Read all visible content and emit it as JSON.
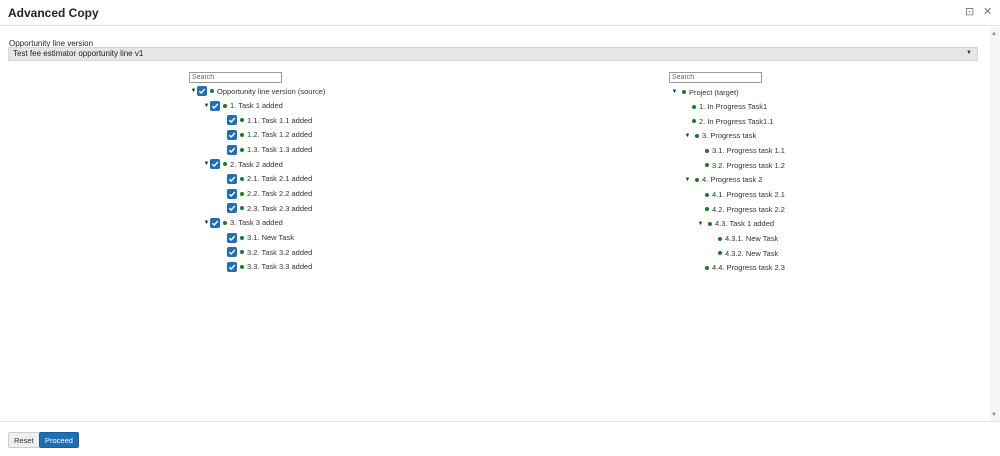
{
  "window": {
    "title": "Advanced Copy"
  },
  "version": {
    "label": "Opportunity line version",
    "selected": "Test fee estimator opportunity line v1"
  },
  "source": {
    "search_placeholder": "Search",
    "root": "Opportunity line version (source)",
    "nodes": [
      {
        "label": "1. Task 1 added",
        "level": 1,
        "expandable": true
      },
      {
        "label": "1.1. Task 1.1 added",
        "level": 2,
        "expandable": false
      },
      {
        "label": "1.2. Task 1.2 added",
        "level": 2,
        "expandable": false
      },
      {
        "label": "1.3. Task 1.3 added",
        "level": 2,
        "expandable": false
      },
      {
        "label": "2. Task 2 added",
        "level": 1,
        "expandable": true
      },
      {
        "label": "2.1. Task 2.1 added",
        "level": 2,
        "expandable": false
      },
      {
        "label": "2.2. Task 2.2 added",
        "level": 2,
        "expandable": false
      },
      {
        "label": "2.3. Task 2.3 added",
        "level": 2,
        "expandable": false
      },
      {
        "label": "3. Task 3 added",
        "level": 1,
        "expandable": true
      },
      {
        "label": "3.1. New Task",
        "level": 2,
        "expandable": false
      },
      {
        "label": "3.2. Task 3.2 added",
        "level": 2,
        "expandable": false
      },
      {
        "label": "3.3. Task 3.3 added",
        "level": 2,
        "expandable": false
      }
    ]
  },
  "target": {
    "search_placeholder": "Search",
    "root": "Project (target)",
    "nodes": [
      {
        "label": "1. In Progress Task1",
        "level": 1,
        "expandable": false
      },
      {
        "label": "2. In Progress Task1.1",
        "level": 1,
        "expandable": false
      },
      {
        "label": "3. Progress task",
        "level": 1,
        "expandable": true
      },
      {
        "label": "3.1. Progress task 1.1",
        "level": 2,
        "expandable": false
      },
      {
        "label": "3.2. Progress task 1.2",
        "level": 2,
        "expandable": false
      },
      {
        "label": "4. Progress task 2",
        "level": 1,
        "expandable": true
      },
      {
        "label": "4.1. Progress task 2.1",
        "level": 2,
        "expandable": false
      },
      {
        "label": "4.2. Progress task 2.2",
        "level": 2,
        "expandable": false
      },
      {
        "label": "4.3. Task 1 added",
        "level": 2,
        "expandable": true
      },
      {
        "label": "4.3.1. New Task",
        "level": 3,
        "expandable": false
      },
      {
        "label": "4.3.2. New Task",
        "level": 3,
        "expandable": false
      },
      {
        "label": "4.4. Progress task 2.3",
        "level": 2,
        "expandable": false
      }
    ]
  },
  "footer": {
    "reset": "Reset",
    "proceed": "Proceed"
  },
  "colors": {
    "accent": "#1f6fb5",
    "node_dot": "#1e7a1e"
  }
}
